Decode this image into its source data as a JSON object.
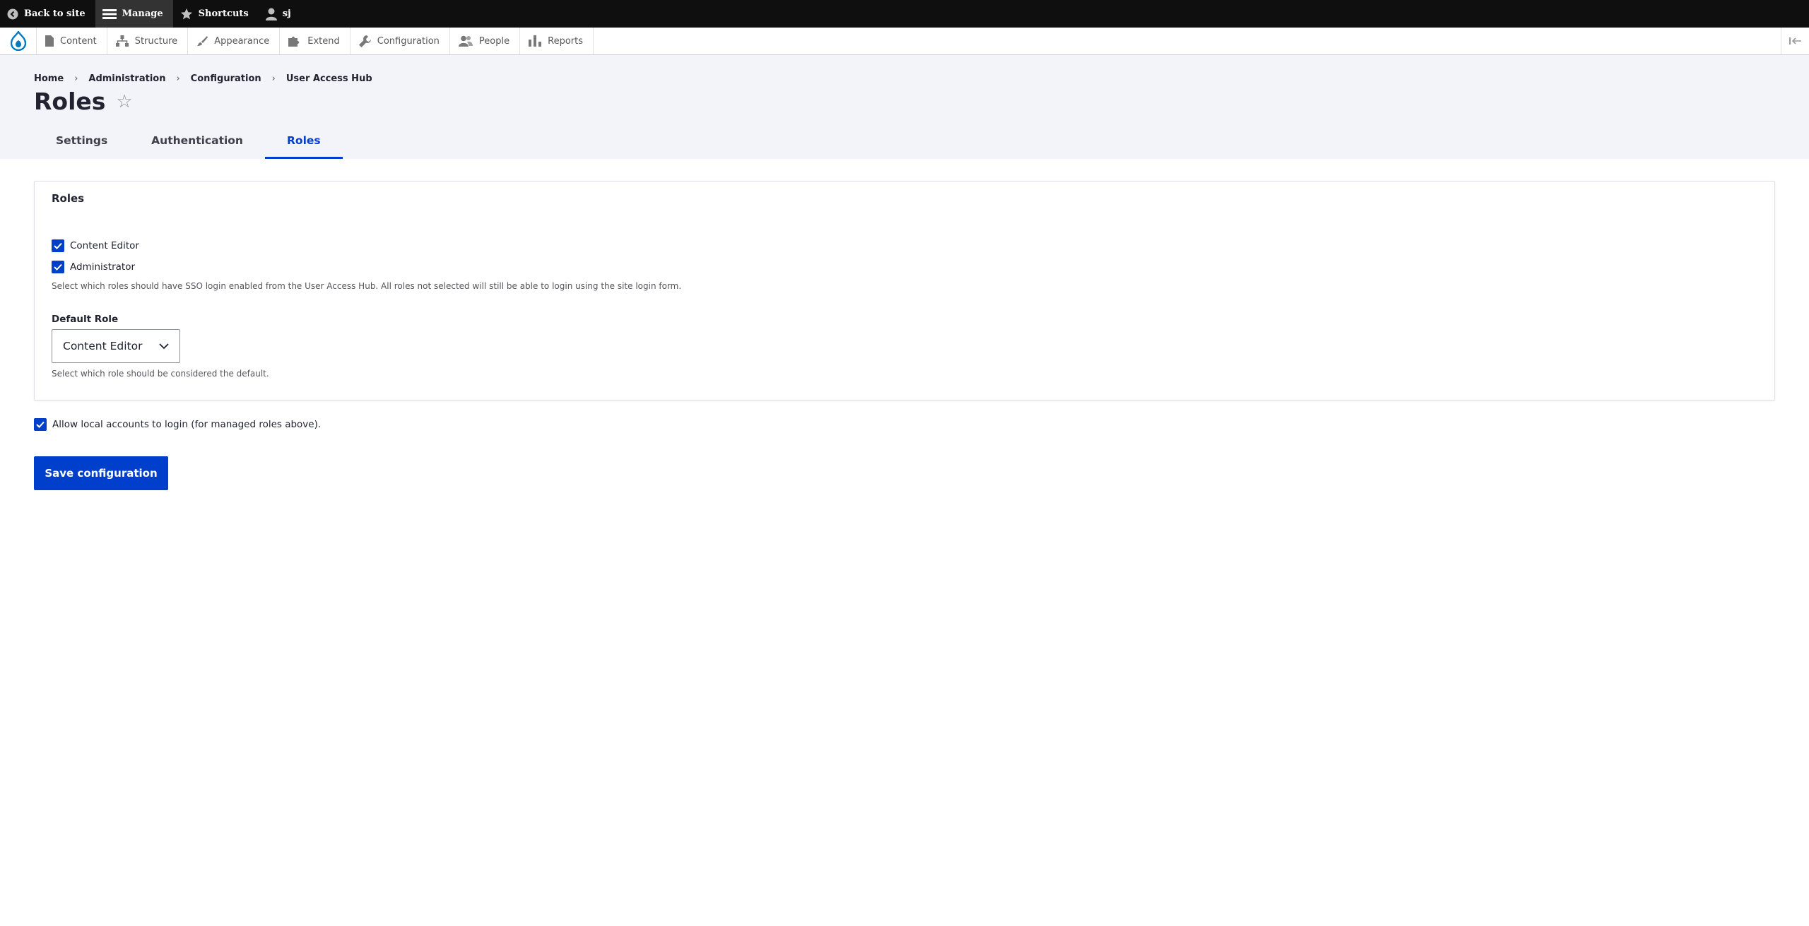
{
  "toolbar": {
    "back_to_site": "Back to site",
    "manage": "Manage",
    "shortcuts": "Shortcuts",
    "user": "sj"
  },
  "menu": {
    "items": [
      "Content",
      "Structure",
      "Appearance",
      "Extend",
      "Configuration",
      "People",
      "Reports"
    ]
  },
  "breadcrumb": [
    "Home",
    "Administration",
    "Configuration",
    "User Access Hub"
  ],
  "page": {
    "title": "Roles",
    "star": "☆"
  },
  "tabs": [
    {
      "label": "Settings",
      "active": false
    },
    {
      "label": "Authentication",
      "active": false
    },
    {
      "label": "Roles",
      "active": true
    }
  ],
  "roles_fieldset": {
    "legend": "Roles",
    "options": [
      {
        "label": "Content Editor",
        "checked": true
      },
      {
        "label": "Administrator",
        "checked": true
      }
    ],
    "description": "Select which roles should have SSO login enabled from the User Access Hub. All roles not selected will still be able to login using the site login form.",
    "default_role_label": "Default Role",
    "default_role_value": "Content Editor",
    "default_role_description": "Select which role should be considered the default."
  },
  "allow_local": {
    "label": "Allow local accounts to login (for managed roles above).",
    "checked": true
  },
  "save_label": "Save configuration",
  "colors": {
    "accent": "#003ecc",
    "toolbar_bg": "#0f0f0f",
    "header_bg": "#f3f4f9"
  }
}
